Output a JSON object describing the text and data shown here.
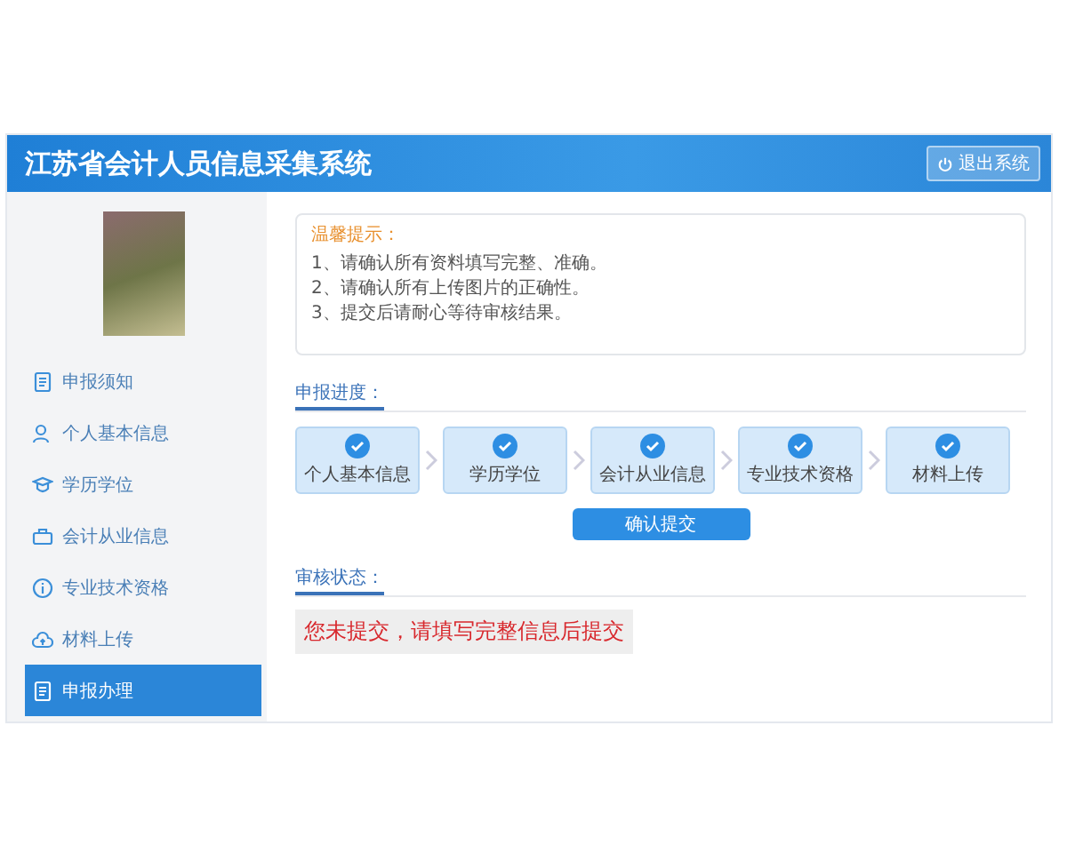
{
  "header": {
    "title": "江苏省会计人员信息采集系统",
    "logout": "退出系统"
  },
  "sidebar": {
    "items": [
      {
        "label": "申报须知",
        "kind": "doc",
        "selected": false
      },
      {
        "label": "个人基本信息",
        "kind": "person",
        "selected": false
      },
      {
        "label": "学历学位",
        "kind": "cap",
        "selected": false
      },
      {
        "label": "会计从业信息",
        "kind": "briefcase",
        "selected": false
      },
      {
        "label": "专业技术资格",
        "kind": "info",
        "selected": false
      },
      {
        "label": "材料上传",
        "kind": "cloud",
        "selected": false
      },
      {
        "label": "申报办理",
        "kind": "doc",
        "selected": true
      }
    ]
  },
  "tips": {
    "title": "温馨提示：",
    "items": [
      "1、请确认所有资料填写完整、准确。",
      "2、请确认所有上传图片的正确性。",
      "3、提交后请耐心等待审核结果。"
    ]
  },
  "progress": {
    "title": "申报进度：",
    "steps": [
      {
        "label": "个人基本信息",
        "done": true
      },
      {
        "label": "学历学位",
        "done": true
      },
      {
        "label": "会计从业信息",
        "done": true
      },
      {
        "label": "专业技术资格",
        "done": true
      },
      {
        "label": "材料上传",
        "done": true
      }
    ],
    "submit": "确认提交"
  },
  "status": {
    "title": "审核状态：",
    "message": "您未提交，请填写完整信息后提交"
  }
}
